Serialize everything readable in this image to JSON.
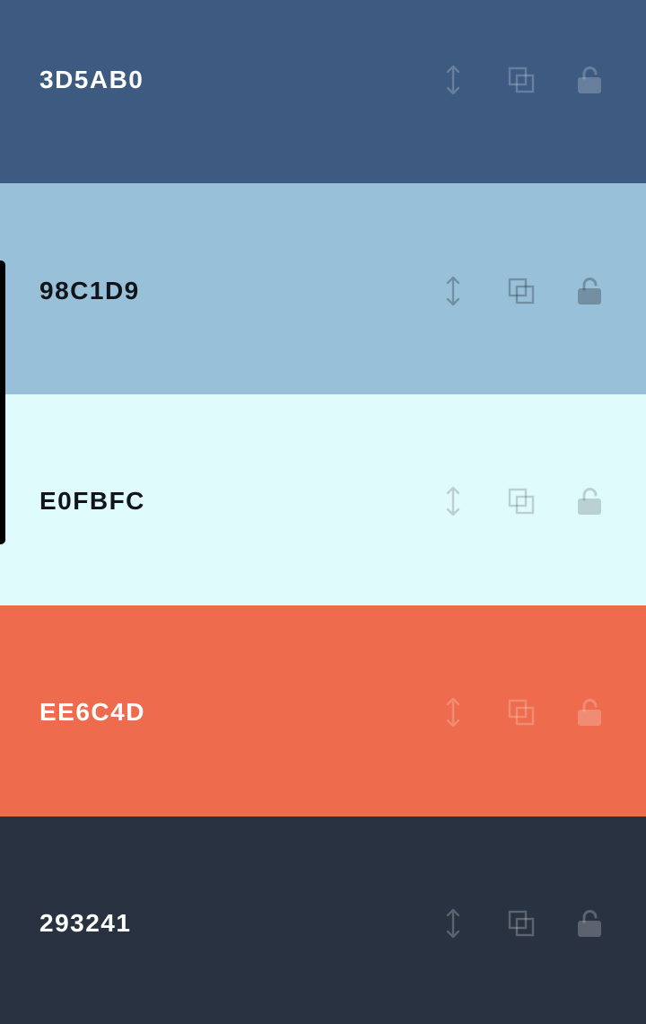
{
  "palette": {
    "colors": [
      {
        "hex": "3D5AB0",
        "bg": "#3D5A80",
        "text_color": "#FFFFFF",
        "icon_color": "rgba(255,255,255,0.22)",
        "lock_fill": "rgba(255,255,255,0.22)",
        "locked": false
      },
      {
        "hex": "98C1D9",
        "bg": "#98C1D9",
        "text_color": "#111418",
        "icon_color": "rgba(0,0,0,0.25)",
        "lock_fill": "rgba(0,0,0,0.25)",
        "locked": false
      },
      {
        "hex": "E0FBFC",
        "bg": "#E0FBFC",
        "text_color": "#111418",
        "icon_color": "rgba(0,0,0,0.17)",
        "lock_fill": "rgba(0,0,0,0.17)",
        "locked": false
      },
      {
        "hex": "EE6C4D",
        "bg": "#EE6C4D",
        "text_color": "#FFFFFF",
        "icon_color": "rgba(255,255,255,0.22)",
        "lock_fill": "rgba(255,255,255,0.22)",
        "locked": false
      },
      {
        "hex": "293241",
        "bg": "#293241",
        "text_color": "#FFFFFF",
        "icon_color": "rgba(255,255,255,0.24)",
        "lock_fill": "rgba(255,255,255,0.24)",
        "locked": false
      }
    ],
    "tool_icons": [
      "drag-handle-icon",
      "copy-icon",
      "unlock-icon"
    ]
  }
}
